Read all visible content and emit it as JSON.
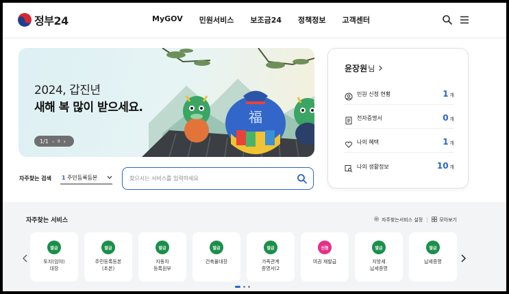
{
  "header": {
    "logo_text": "정부24",
    "nav": [
      "MyGOV",
      "민원서비스",
      "보조금24",
      "정책정보",
      "고객센터"
    ],
    "icons": [
      "search-icon",
      "menu-icon"
    ]
  },
  "banner": {
    "line1": "2024, 갑진년",
    "line2": "새해 복 많이 받으세요.",
    "pager": "1/1",
    "pager_prev": "‹",
    "pager_pause": "II",
    "pager_next": "›",
    "bag_char": "福"
  },
  "search": {
    "label": "자주찾는 검색",
    "select_num": "1",
    "select_value": "주민등록등본",
    "placeholder": "찾으시는 서비스를 입력하세요"
  },
  "profile": {
    "name": "윤장원",
    "suffix": "님",
    "rows": [
      {
        "icon": "person-circle-icon",
        "label": "민원 신청 현황",
        "count": "1",
        "unit": "개"
      },
      {
        "icon": "document-icon",
        "label": "전자증명서",
        "count": "0",
        "unit": "개"
      },
      {
        "icon": "heart-icon",
        "label": "나의 혜택",
        "count": "1",
        "unit": "개"
      },
      {
        "icon": "search-doc-icon",
        "label": "나의 생활정보",
        "count": "10",
        "unit": "개"
      }
    ]
  },
  "services": {
    "title": "자주찾는 서비스",
    "settings_label": "자주찾는서비스 설정",
    "viewall_label": "모아보기",
    "items": [
      {
        "badge": "발급",
        "label": "토지(임야)\n대장",
        "color": "#1a8f4a"
      },
      {
        "badge": "발급",
        "label": "주민등록등본\n(초본)",
        "color": "#1a8f4a"
      },
      {
        "badge": "발급",
        "label": "자동차\n등록원부",
        "color": "#1a8f4a"
      },
      {
        "badge": "발급",
        "label": "건축물대장",
        "color": "#1a8f4a"
      },
      {
        "badge": "발급",
        "label": "가족관계\n증명서(2",
        "color": "#1a8f4a"
      },
      {
        "badge": "신청",
        "label": "여권 재발급",
        "color": "#e4308a"
      },
      {
        "badge": "발급",
        "label": "지방세\n납세증명",
        "color": "#1a8f4a"
      },
      {
        "badge": "발급",
        "label": "납세증명",
        "color": "#1a8f4a"
      }
    ]
  }
}
